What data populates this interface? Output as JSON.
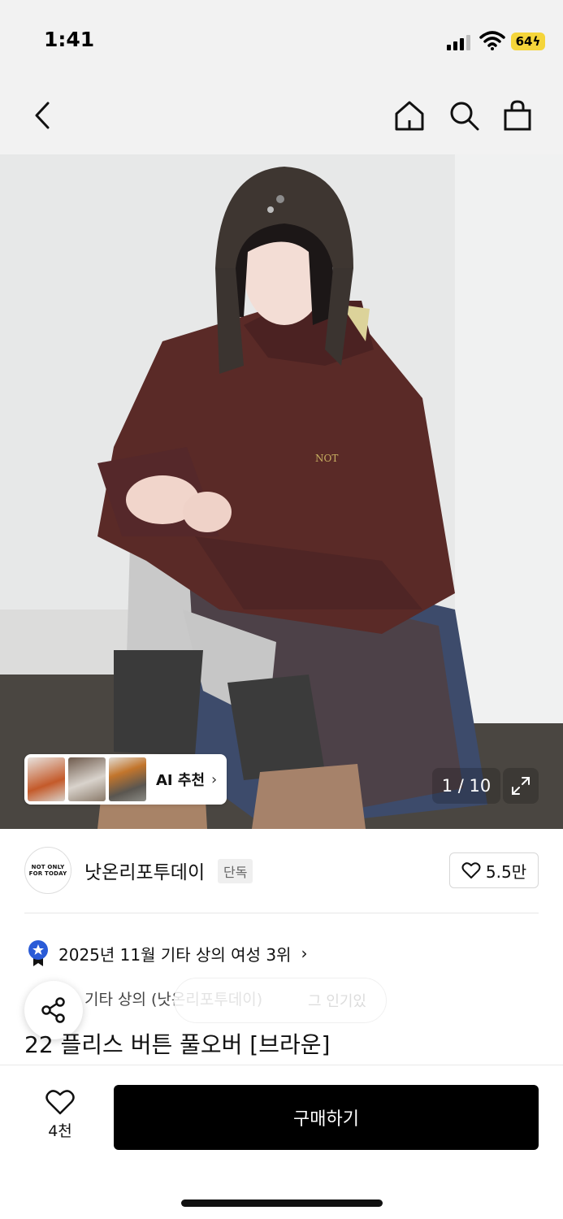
{
  "status_bar": {
    "time": "1:41",
    "battery": "64"
  },
  "nav": {
    "icons": [
      "back-icon",
      "home-icon",
      "search-icon",
      "shopping-bag-icon"
    ]
  },
  "gallery": {
    "ai_recommend_label": "AI 추천",
    "counter": "1 / 10",
    "current_image": 1,
    "total_images": 10
  },
  "brand": {
    "logo_line1": "NOT ONLY",
    "logo_line2": "FOR TODAY",
    "name": "낫온리포투데이",
    "badge": "단독",
    "likes": "5.5만"
  },
  "ranking": {
    "text": "2025년 11월 기타 상의 여성 3위"
  },
  "product": {
    "category": "기타 상의 (낫온리포투데이)",
    "faded_overlay_text": "그 인기있",
    "title": "22 플리스 버튼 풀오버 [브라운]"
  },
  "bottom_bar": {
    "wish_count": "4천",
    "buy_label": "구매하기"
  },
  "colors": {
    "accent_blue": "#2a5bd7",
    "battery_yellow": "#f5d53a",
    "buy_button": "#000000"
  }
}
